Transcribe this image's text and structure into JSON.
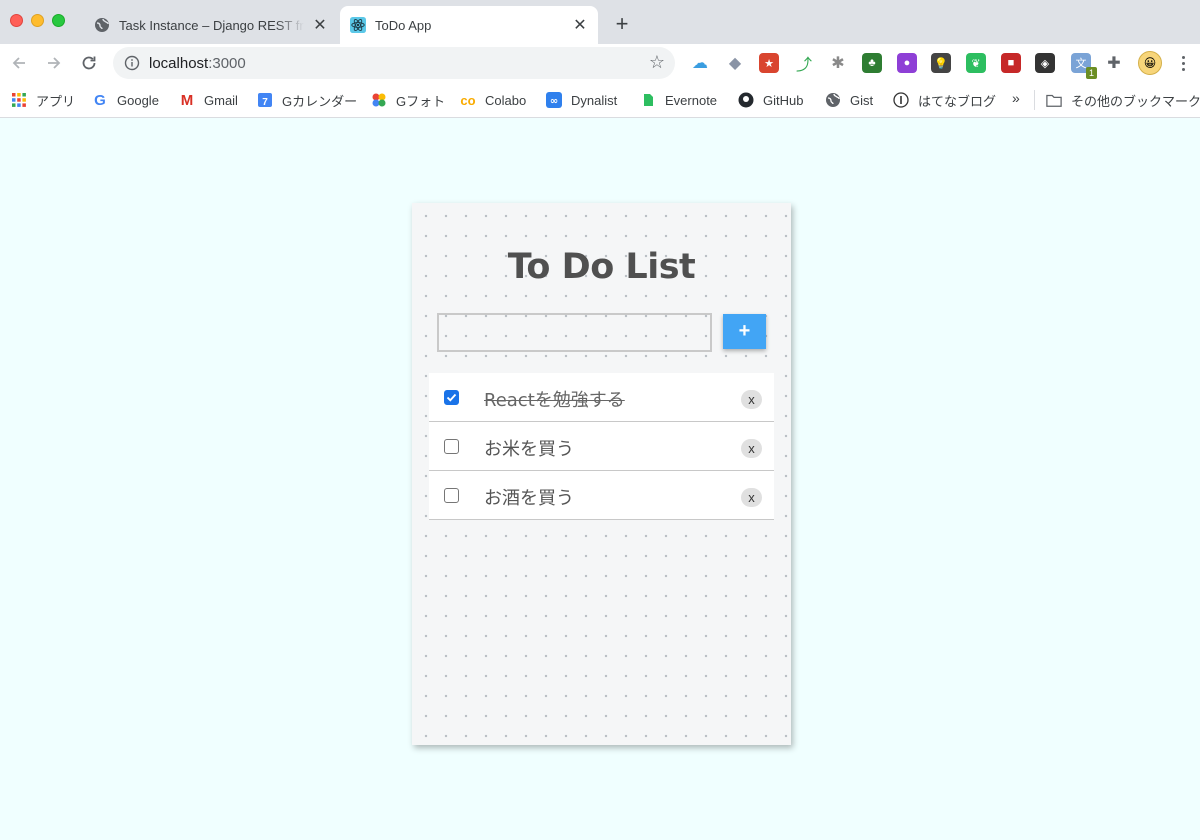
{
  "browser": {
    "tabs": [
      {
        "title": "Task Instance – Django REST fr",
        "active": false,
        "favicon": "globe-icon"
      },
      {
        "title": "ToDo App",
        "active": true,
        "favicon": "react-icon"
      }
    ],
    "url_host": "localhost",
    "url_port": ":3000",
    "extensions": [
      {
        "name": "icloud-icon",
        "color": "#3a9de0"
      },
      {
        "name": "dropbox-icon",
        "color": "#8a94a6"
      },
      {
        "name": "bookmark-star-icon",
        "color": "#d9452f"
      },
      {
        "name": "share-icon",
        "color": "#34a853"
      },
      {
        "name": "bug-icon",
        "color": "#8a8a8a"
      },
      {
        "name": "html-tree-icon",
        "color": "#2e7d32"
      },
      {
        "name": "purple-circle-icon",
        "color": "#8e3fd6"
      },
      {
        "name": "lightbulb-icon",
        "color": "#444444"
      },
      {
        "name": "evernote-icon",
        "color": "#2dbe60"
      },
      {
        "name": "red-square-icon",
        "color": "#c62828"
      },
      {
        "name": "cube-icon",
        "color": "#333333"
      },
      {
        "name": "translate-icon",
        "color": "#7aa3d6"
      },
      {
        "name": "puzzle-icon",
        "color": "#5f6368"
      }
    ],
    "extension_badge": "1",
    "bookmarks": [
      {
        "label": "アプリ",
        "icon": "apps-grid-icon"
      },
      {
        "label": "Google",
        "icon": "google-icon"
      },
      {
        "label": "Gmail",
        "icon": "gmail-icon"
      },
      {
        "label": "Gカレンダー",
        "icon": "calendar-icon"
      },
      {
        "label": "Gフォト",
        "icon": "photos-icon"
      },
      {
        "label": "Colabo",
        "icon": "colab-icon"
      },
      {
        "label": "Dynalist",
        "icon": "dynalist-icon"
      },
      {
        "label": "Evernote",
        "icon": "evernote-icon"
      },
      {
        "label": "GitHub",
        "icon": "github-icon"
      },
      {
        "label": "Gist",
        "icon": "globe-icon"
      },
      {
        "label": "はてなブログ",
        "icon": "hatena-icon"
      }
    ],
    "bookmarks_more": "»",
    "other_bookmarks": "その他のブックマーク"
  },
  "app": {
    "title": "To Do List",
    "input_value": "",
    "add_label": "+",
    "todos": [
      {
        "text": "Reactを勉強する",
        "done": true
      },
      {
        "text": "お米を買う",
        "done": false
      },
      {
        "text": "お酒を買う",
        "done": false
      }
    ],
    "delete_label": "x"
  }
}
